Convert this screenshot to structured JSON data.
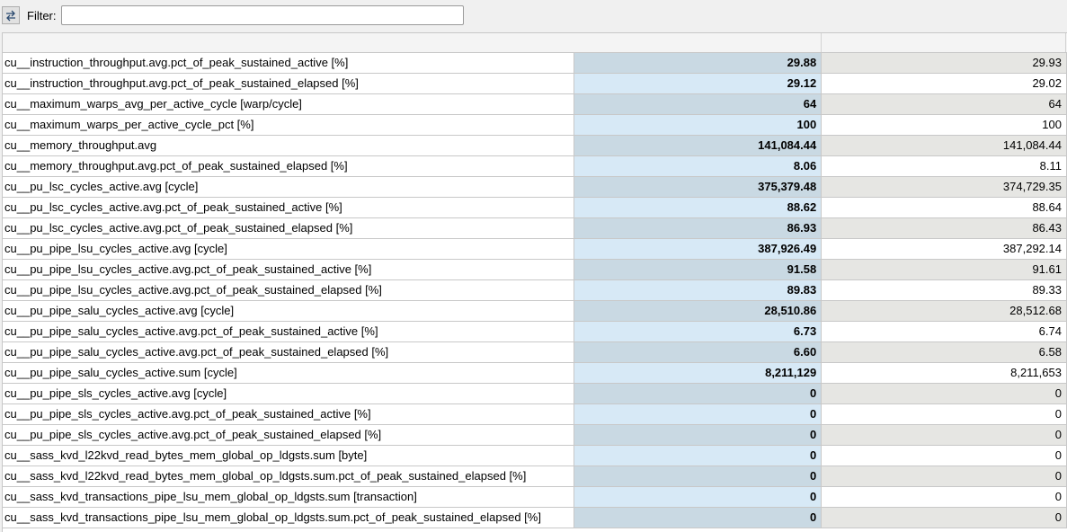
{
  "toolbar": {
    "swap_icon": "swap-arrows-icon",
    "filter_label": "Filter:",
    "filter_value": "",
    "filter_placeholder": ""
  },
  "table": {
    "columns": [
      "",
      "",
      ""
    ],
    "rows": [
      {
        "name": "cu__instruction_throughput.avg.pct_of_peak_sustained_active [%]",
        "current": "29.88",
        "baseline": "29.93"
      },
      {
        "name": "cu__instruction_throughput.avg.pct_of_peak_sustained_elapsed [%]",
        "current": "29.12",
        "baseline": "29.02"
      },
      {
        "name": "cu__maximum_warps_avg_per_active_cycle [warp/cycle]",
        "current": "64",
        "baseline": "64"
      },
      {
        "name": "cu__maximum_warps_per_active_cycle_pct [%]",
        "current": "100",
        "baseline": "100"
      },
      {
        "name": "cu__memory_throughput.avg",
        "current": "141,084.44",
        "baseline": "141,084.44"
      },
      {
        "name": "cu__memory_throughput.avg.pct_of_peak_sustained_elapsed [%]",
        "current": "8.06",
        "baseline": "8.11"
      },
      {
        "name": "cu__pu_lsc_cycles_active.avg [cycle]",
        "current": "375,379.48",
        "baseline": "374,729.35"
      },
      {
        "name": "cu__pu_lsc_cycles_active.avg.pct_of_peak_sustained_active [%]",
        "current": "88.62",
        "baseline": "88.64"
      },
      {
        "name": "cu__pu_lsc_cycles_active.avg.pct_of_peak_sustained_elapsed [%]",
        "current": "86.93",
        "baseline": "86.43"
      },
      {
        "name": "cu__pu_pipe_lsu_cycles_active.avg [cycle]",
        "current": "387,926.49",
        "baseline": "387,292.14"
      },
      {
        "name": "cu__pu_pipe_lsu_cycles_active.avg.pct_of_peak_sustained_active [%]",
        "current": "91.58",
        "baseline": "91.61"
      },
      {
        "name": "cu__pu_pipe_lsu_cycles_active.avg.pct_of_peak_sustained_elapsed [%]",
        "current": "89.83",
        "baseline": "89.33"
      },
      {
        "name": "cu__pu_pipe_salu_cycles_active.avg [cycle]",
        "current": "28,510.86",
        "baseline": "28,512.68"
      },
      {
        "name": "cu__pu_pipe_salu_cycles_active.avg.pct_of_peak_sustained_active [%]",
        "current": "6.73",
        "baseline": "6.74"
      },
      {
        "name": "cu__pu_pipe_salu_cycles_active.avg.pct_of_peak_sustained_elapsed [%]",
        "current": "6.60",
        "baseline": "6.58"
      },
      {
        "name": "cu__pu_pipe_salu_cycles_active.sum [cycle]",
        "current": "8,211,129",
        "baseline": "8,211,653"
      },
      {
        "name": "cu__pu_pipe_sls_cycles_active.avg [cycle]",
        "current": "0",
        "baseline": "0"
      },
      {
        "name": "cu__pu_pipe_sls_cycles_active.avg.pct_of_peak_sustained_active [%]",
        "current": "0",
        "baseline": "0"
      },
      {
        "name": "cu__pu_pipe_sls_cycles_active.avg.pct_of_peak_sustained_elapsed [%]",
        "current": "0",
        "baseline": "0"
      },
      {
        "name": "cu__sass_kvd_l22kvd_read_bytes_mem_global_op_ldgsts.sum [byte]",
        "current": "0",
        "baseline": "0"
      },
      {
        "name": "cu__sass_kvd_l22kvd_read_bytes_mem_global_op_ldgsts.sum.pct_of_peak_sustained_elapsed [%]",
        "current": "0",
        "baseline": "0"
      },
      {
        "name": "cu__sass_kvd_transactions_pipe_lsu_mem_global_op_ldgsts.sum [transaction]",
        "current": "0",
        "baseline": "0"
      },
      {
        "name": "cu__sass_kvd_transactions_pipe_lsu_mem_global_op_ldgsts.sum.pct_of_peak_sustained_elapsed [%]",
        "current": "0",
        "baseline": "0"
      }
    ]
  },
  "colors": {
    "current_col_odd": "#c9d9e3",
    "current_col_even": "#d7e9f6",
    "baseline_col_odd": "#e6e6e3",
    "baseline_col_even": "#ffffff",
    "grid": "#c8c8c8"
  }
}
